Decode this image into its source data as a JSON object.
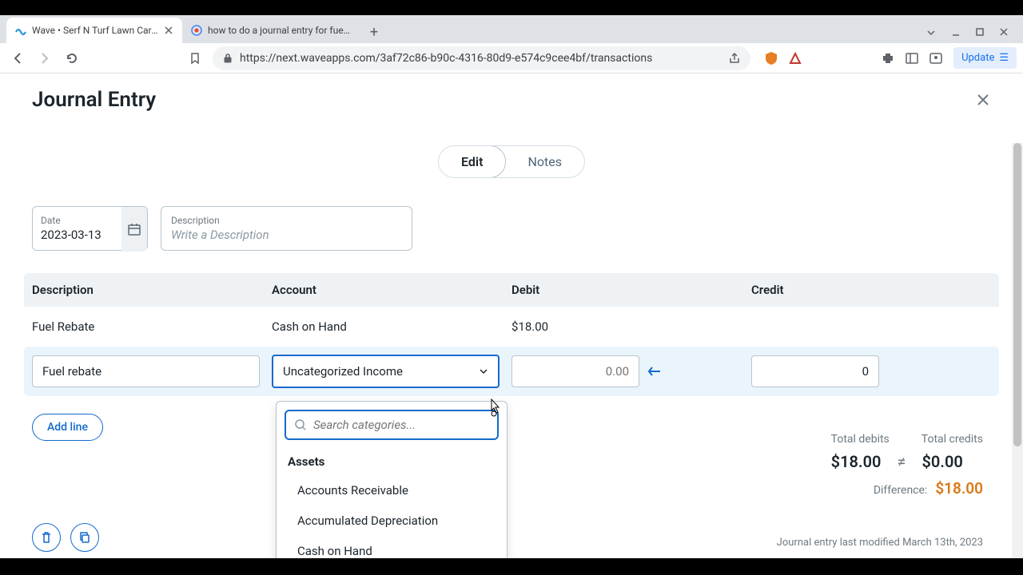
{
  "browser": {
    "tabs": [
      {
        "title": "Wave • Serf N Turf Lawn Care • T",
        "active": true
      },
      {
        "title": "how to do a journal entry for fuel reb",
        "active": false
      }
    ],
    "url": "https://next.waveapps.com/3af72c86-b90c-4316-80d9-e574c9cee4bf/transactions",
    "update_label": "Update"
  },
  "page": {
    "title": "Journal Entry",
    "tabs": {
      "edit": "Edit",
      "notes": "Notes"
    },
    "date_label": "Date",
    "date_value": "2023-03-13",
    "desc_label": "Description",
    "desc_placeholder": "Write a Description",
    "columns": {
      "description": "Description",
      "account": "Account",
      "debit": "Debit",
      "credit": "Credit"
    },
    "rows": [
      {
        "description": "Fuel Rebate",
        "account": "Cash on Hand",
        "debit": "$18.00",
        "credit": ""
      }
    ],
    "editing_row": {
      "description": "Fuel rebate",
      "account": "Uncategorized Income",
      "debit_placeholder": "0.00",
      "credit_value": "0"
    },
    "add_line": "Add line",
    "dropdown": {
      "search_placeholder": "Search categories...",
      "group": "Assets",
      "items": [
        "Accounts Receivable",
        "Accumulated Depreciation",
        "Cash on Hand"
      ]
    },
    "totals": {
      "debits_label": "Total debits",
      "credits_label": "Total credits",
      "debits": "$18.00",
      "noteq": "≠",
      "credits": "$0.00",
      "diff_label": "Difference:",
      "diff": "$18.00"
    },
    "modified": "Journal entry last modified March 13th, 2023"
  }
}
